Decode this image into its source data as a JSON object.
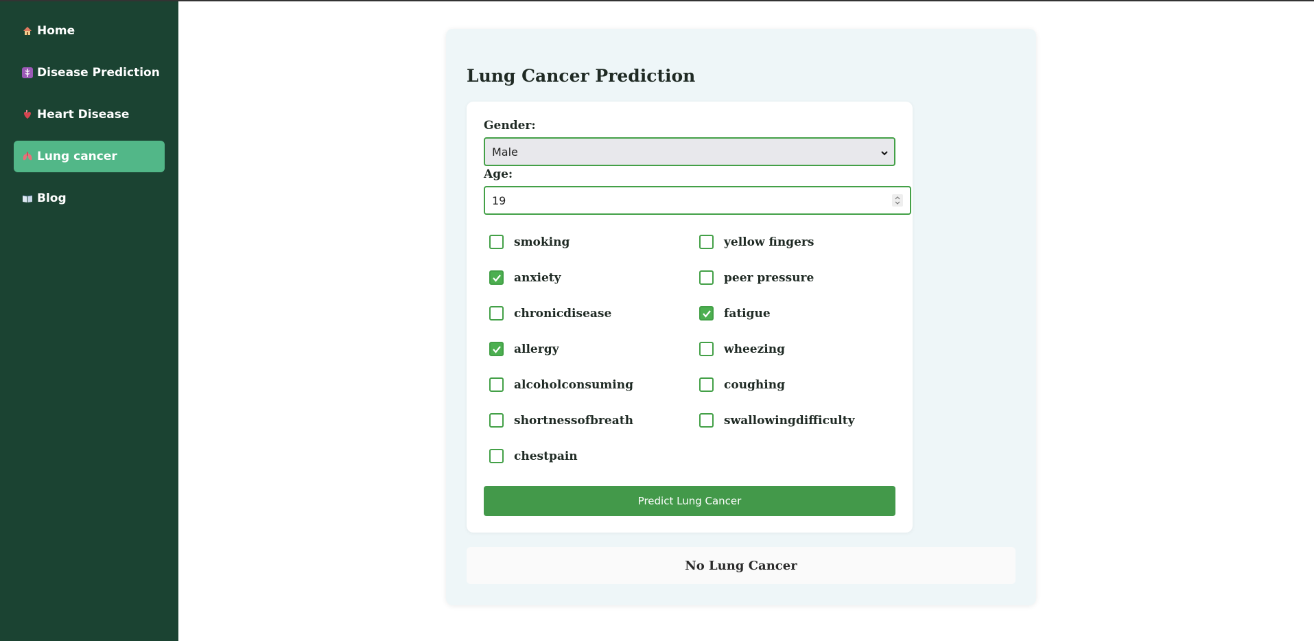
{
  "sidebar": {
    "items": [
      {
        "label": "Home",
        "icon": "house-icon"
      },
      {
        "label": "Disease Prediction",
        "icon": "medical-symbol-icon"
      },
      {
        "label": "Heart Disease",
        "icon": "anatomical-heart-icon"
      },
      {
        "label": "Lung cancer",
        "icon": "lungs-icon",
        "active": true
      },
      {
        "label": "Blog",
        "icon": "open-book-icon"
      }
    ]
  },
  "page": {
    "title": "Lung Cancer Prediction"
  },
  "form": {
    "gender_label": "Gender:",
    "gender_value": "Male",
    "age_label": "Age:",
    "age_value": "19",
    "checkboxes": [
      {
        "label": "smoking",
        "checked": false
      },
      {
        "label": "yellow fingers",
        "checked": false
      },
      {
        "label": "anxiety",
        "checked": true
      },
      {
        "label": "peer pressure",
        "checked": false
      },
      {
        "label": "chronicdisease",
        "checked": false
      },
      {
        "label": "fatigue",
        "checked": true
      },
      {
        "label": "allergy",
        "checked": true
      },
      {
        "label": "wheezing",
        "checked": false
      },
      {
        "label": "alcoholconsuming",
        "checked": false
      },
      {
        "label": "coughing",
        "checked": false
      },
      {
        "label": "shortnessofbreath",
        "checked": false
      },
      {
        "label": "swallowingdifficulty",
        "checked": false
      },
      {
        "label": "chestpain",
        "checked": false
      }
    ],
    "submit_label": "Predict Lung Cancer"
  },
  "result": {
    "text": "No Lung Cancer"
  },
  "colors": {
    "sidebar_bg": "#1b4332",
    "active_item": "#52b788",
    "accent_green": "#43a047",
    "button_green": "#43994a"
  }
}
